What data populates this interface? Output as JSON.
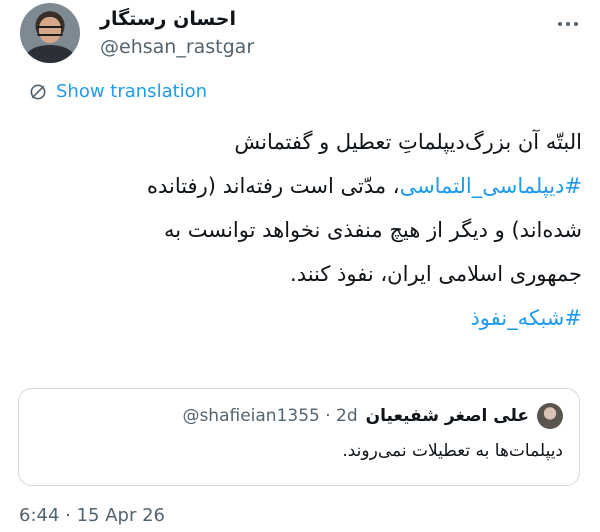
{
  "author": {
    "name": "احسان رستگار",
    "handle": "@ehsan_rastgar"
  },
  "translate": {
    "label": "Show translation"
  },
  "tweet": {
    "line1": "البتّه آن بزرگ‌دیپلماتِ تعطیل و گفتمانش",
    "hashtag1": "#دیپلماسی_التماسی",
    "line2_rest": "، مدّتی است رفته‌اند (رفتانده",
    "line3": "شده‌اند) و دیگر از هیچ منفذی نخواهد توانست به",
    "line4": "جمهوری اسلامی ایران، نفوذ کنند.",
    "hashtag2": "#شبکه_نفوذ"
  },
  "quote": {
    "name": "علی اصغر شفیعیان",
    "meta": "@shafieian1355 · 2d",
    "text": "دیپلمات‌ها به تعطیلات نمی‌روند."
  },
  "timestamp": "6:44 · 15 Apr 26",
  "colors": {
    "accent": "#1d9bf0",
    "secondary_text": "#536471",
    "border": "#cfd9de"
  },
  "icons": {
    "translate": "translate-icon",
    "more": "more-icon"
  }
}
